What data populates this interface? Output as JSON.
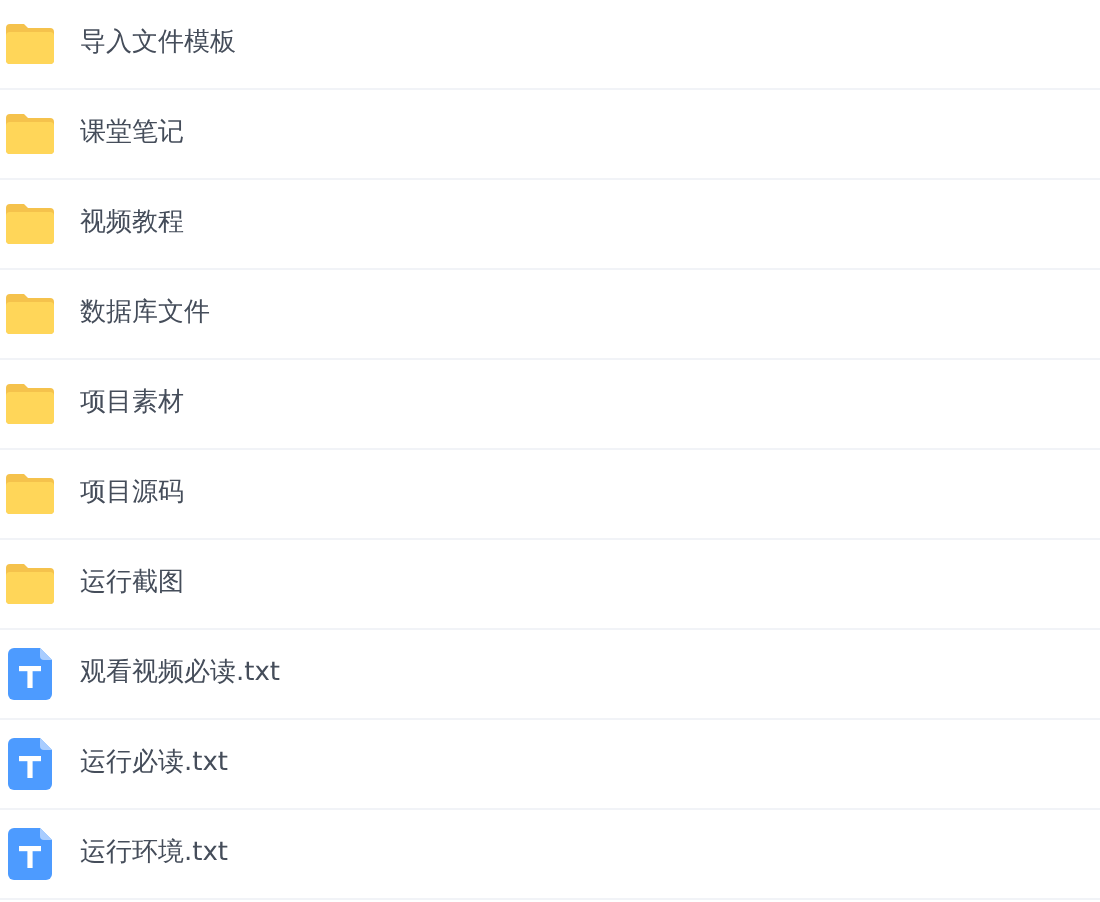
{
  "files": [
    {
      "name": "导入文件模板",
      "kind": "folder"
    },
    {
      "name": "课堂笔记",
      "kind": "folder"
    },
    {
      "name": "视频教程",
      "kind": "folder"
    },
    {
      "name": "数据库文件",
      "kind": "folder"
    },
    {
      "name": "项目素材",
      "kind": "folder"
    },
    {
      "name": "项目源码",
      "kind": "folder"
    },
    {
      "name": "运行截图",
      "kind": "folder"
    },
    {
      "name": "观看视频必读.txt",
      "kind": "text"
    },
    {
      "name": "运行必读.txt",
      "kind": "text"
    },
    {
      "name": "运行环境.txt",
      "kind": "text"
    }
  ]
}
